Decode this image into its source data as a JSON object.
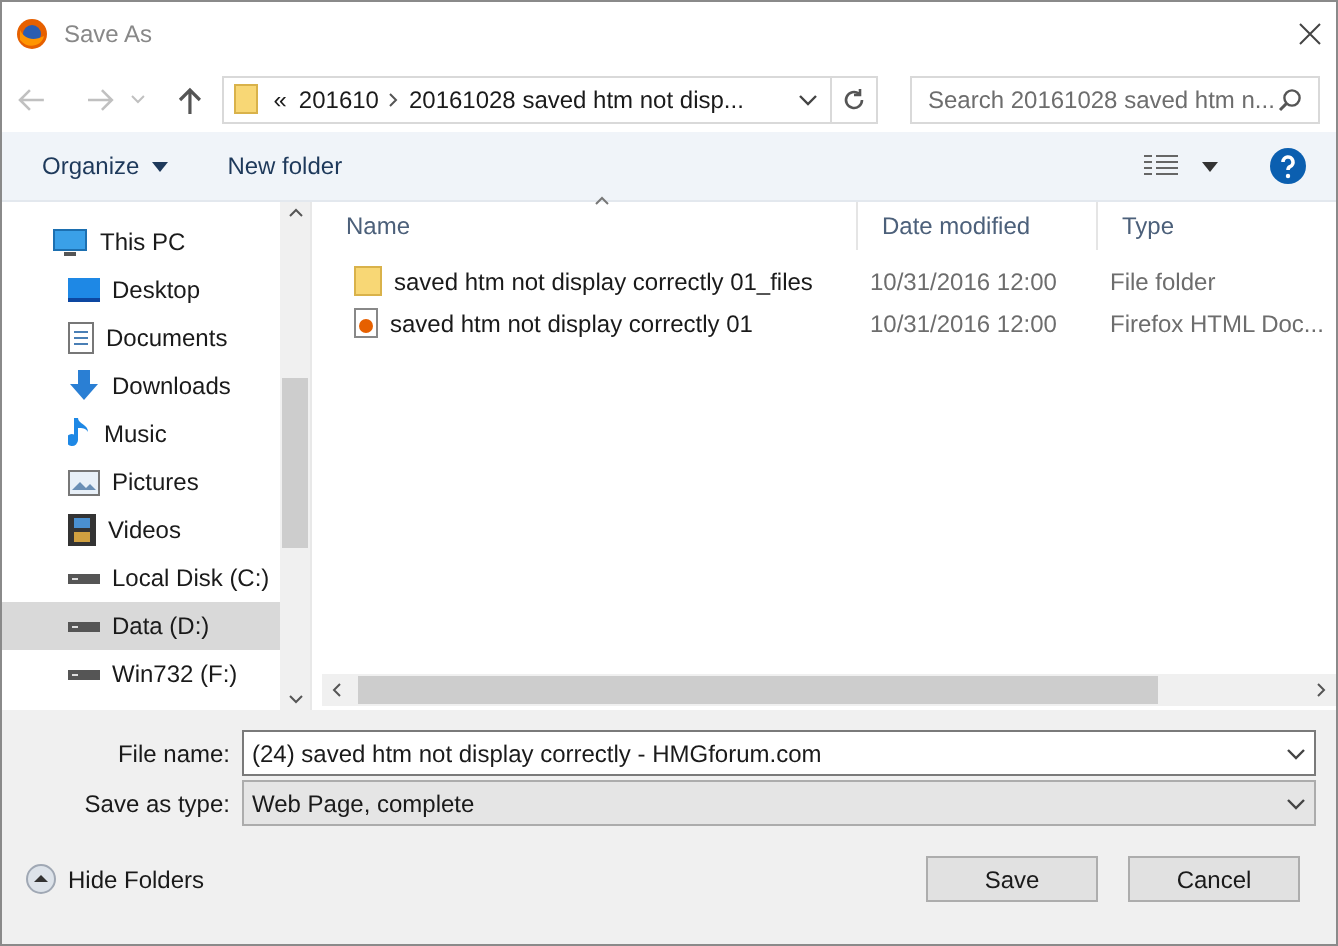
{
  "window": {
    "title": "Save As"
  },
  "address": {
    "overflow": "«",
    "crumbs": [
      "201610",
      "20161028 saved htm not disp..."
    ]
  },
  "search": {
    "placeholder": "Search 20161028 saved htm n..."
  },
  "toolbar": {
    "organize": "Organize",
    "new_folder": "New folder"
  },
  "sidebar": {
    "items": [
      {
        "label": "This PC",
        "kind": "pc",
        "selected": false
      },
      {
        "label": "Desktop",
        "kind": "desktop",
        "selected": false
      },
      {
        "label": "Documents",
        "kind": "documents",
        "selected": false
      },
      {
        "label": "Downloads",
        "kind": "downloads",
        "selected": false
      },
      {
        "label": "Music",
        "kind": "music",
        "selected": false
      },
      {
        "label": "Pictures",
        "kind": "pictures",
        "selected": false
      },
      {
        "label": "Videos",
        "kind": "videos",
        "selected": false
      },
      {
        "label": "Local Disk (C:)",
        "kind": "drive",
        "selected": false
      },
      {
        "label": "Data (D:)",
        "kind": "drive",
        "selected": true
      },
      {
        "label": "Win732 (F:)",
        "kind": "drive",
        "selected": false
      }
    ]
  },
  "table": {
    "columns": [
      "Name",
      "Date modified",
      "Type"
    ],
    "rows": [
      {
        "kind": "folder",
        "name": "saved htm not display correctly 01_files",
        "date": "10/31/2016 12:00",
        "type": "File folder"
      },
      {
        "kind": "html",
        "name": "saved htm not display correctly 01",
        "date": "10/31/2016 12:00",
        "type": "Firefox HTML Doc..."
      }
    ]
  },
  "form": {
    "file_name_label": "File name:",
    "file_name": "(24) saved htm not display correctly - HMGforum.com",
    "type_label": "Save as type:",
    "type": "Web Page, complete"
  },
  "hide_folders": "Hide Folders",
  "buttons": [
    "Save",
    "Cancel"
  ]
}
